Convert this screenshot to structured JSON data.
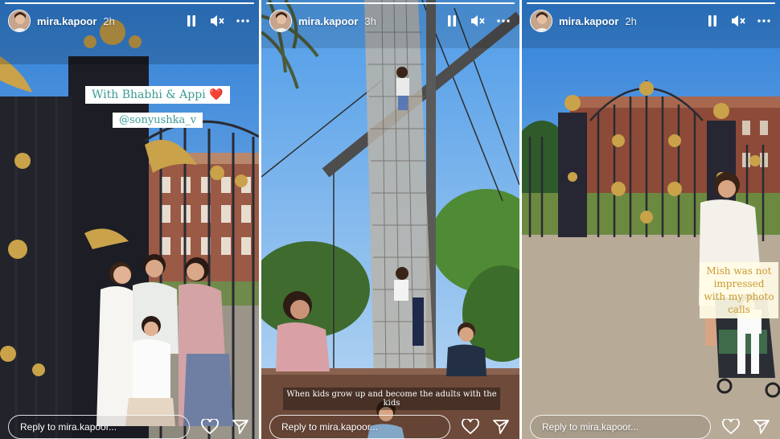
{
  "stories": [
    {
      "username": "mira.kapoor",
      "timestamp": "2h",
      "progress": 1.0,
      "reply_placeholder": "Reply to mira.kapoor...",
      "stickers": [
        "With Bhabhi & Appi",
        "@sonyushka_v"
      ],
      "heart_emoji": "❤️"
    },
    {
      "username": "mira.kapoor",
      "timestamp": "3h",
      "progress": 1.0,
      "reply_placeholder": "Reply to mira.kapoor...",
      "caption": "When kids grow up and become the adults with the kids"
    },
    {
      "username": "mira.kapoor",
      "timestamp": "2h",
      "progress": 1.0,
      "reply_placeholder": "Reply to mira.kapoor...",
      "caption": "Mish was not impressed with my photo calls"
    }
  ],
  "icons": {
    "pause": "pause-icon",
    "mute": "mute-icon",
    "more": "more-icon",
    "like": "heart-icon",
    "share": "send-icon"
  },
  "colors": {
    "sticker_text": "#3b9a95",
    "caption_text": "#c99a2e",
    "sky": "#3c8ee0",
    "gold": "#c9a24a"
  }
}
